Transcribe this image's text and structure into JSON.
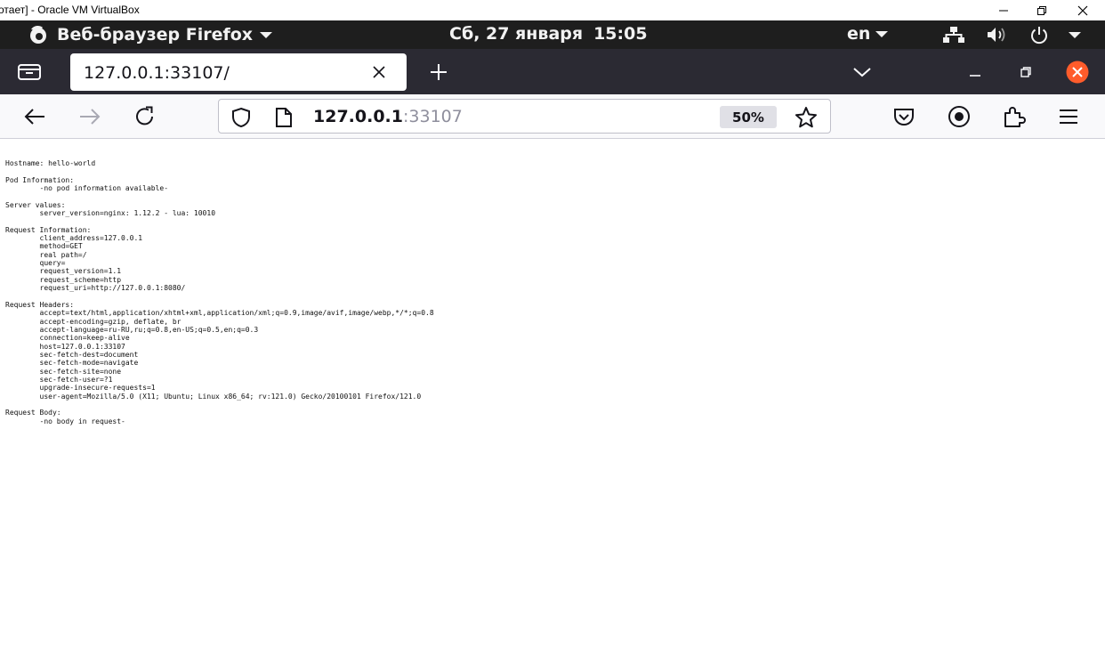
{
  "host_window": {
    "title": "отает] - Oracle VM VirtualBox",
    "controls": [
      "minimize-icon",
      "restore-icon",
      "close-icon"
    ]
  },
  "gnome_panel": {
    "app_name": "Веб-браузер Firefox",
    "date": "Сб, 27 января",
    "time": "15:05",
    "keyboard_layout": "en",
    "icons": [
      "network-icon",
      "volume-icon",
      "power-icon",
      "chevron-down-icon"
    ]
  },
  "browser": {
    "tab": {
      "title": "127.0.0.1:33107/"
    },
    "url": {
      "host": "127.0.0.1",
      "port": ":33107"
    },
    "zoom": "50%",
    "colors": {
      "tabstrip": "#2b2a33",
      "close_button": "#ff5c2b",
      "panel": "#1e1e1e"
    }
  },
  "page": {
    "lines": [
      "Hostname: hello-world",
      "",
      "Pod Information:",
      "\t-no pod information available-",
      "",
      "Server values:",
      "\tserver_version=nginx: 1.12.2 - lua: 10010",
      "",
      "Request Information:",
      "\tclient_address=127.0.0.1",
      "\tmethod=GET",
      "\treal path=/",
      "\tquery=",
      "\trequest_version=1.1",
      "\trequest_scheme=http",
      "\trequest_uri=http://127.0.0.1:8080/",
      "",
      "Request Headers:",
      "\taccept=text/html,application/xhtml+xml,application/xml;q=0.9,image/avif,image/webp,*/*;q=0.8",
      "\taccept-encoding=gzip, deflate, br",
      "\taccept-language=ru-RU,ru;q=0.8,en-US;q=0.5,en;q=0.3",
      "\tconnection=keep-alive",
      "\thost=127.0.0.1:33107",
      "\tsec-fetch-dest=document",
      "\tsec-fetch-mode=navigate",
      "\tsec-fetch-site=none",
      "\tsec-fetch-user=?1",
      "\tupgrade-insecure-requests=1",
      "\tuser-agent=Mozilla/5.0 (X11; Ubuntu; Linux x86_64; rv:121.0) Gecko/20100101 Firefox/121.0",
      "",
      "Request Body:",
      "\t-no body in request-"
    ]
  }
}
